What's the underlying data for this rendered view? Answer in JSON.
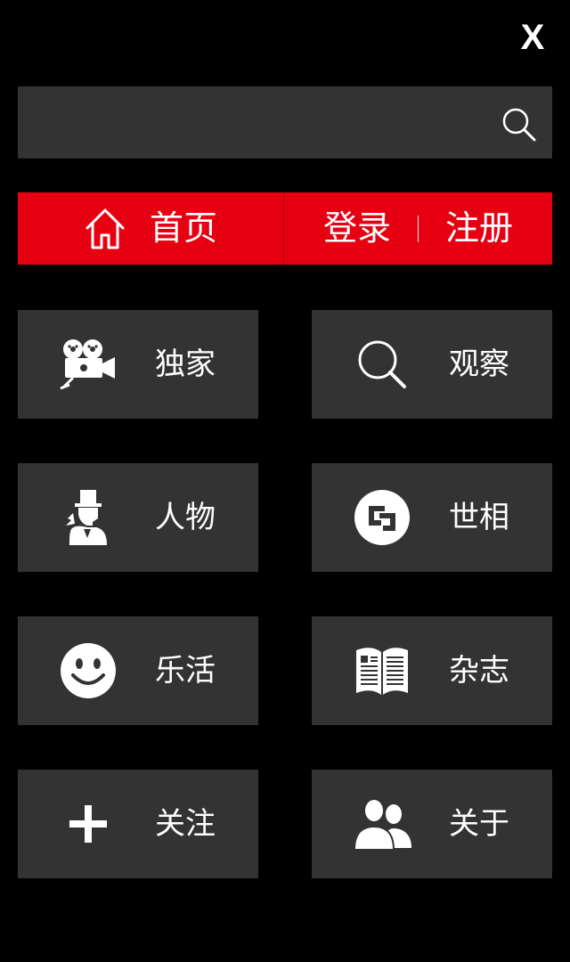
{
  "header": {
    "close_label": "X"
  },
  "search": {
    "value": "",
    "placeholder": ""
  },
  "nav": {
    "home_label": "首页",
    "login_label": "登录",
    "register_label": "注册"
  },
  "tiles": [
    {
      "label": "独家",
      "icon": "movie-camera-icon"
    },
    {
      "label": "观察",
      "icon": "magnifier-icon"
    },
    {
      "label": "人物",
      "icon": "gentleman-icon"
    },
    {
      "label": "世相",
      "icon": "square-logo-icon"
    },
    {
      "label": "乐活",
      "icon": "smiley-icon"
    },
    {
      "label": "杂志",
      "icon": "open-book-icon"
    },
    {
      "label": "关注",
      "icon": "plus-icon"
    },
    {
      "label": "关于",
      "icon": "users-icon"
    }
  ],
  "colors": {
    "background": "#000000",
    "tile": "#333333",
    "accent": "#e60012",
    "text": "#ffffff"
  }
}
